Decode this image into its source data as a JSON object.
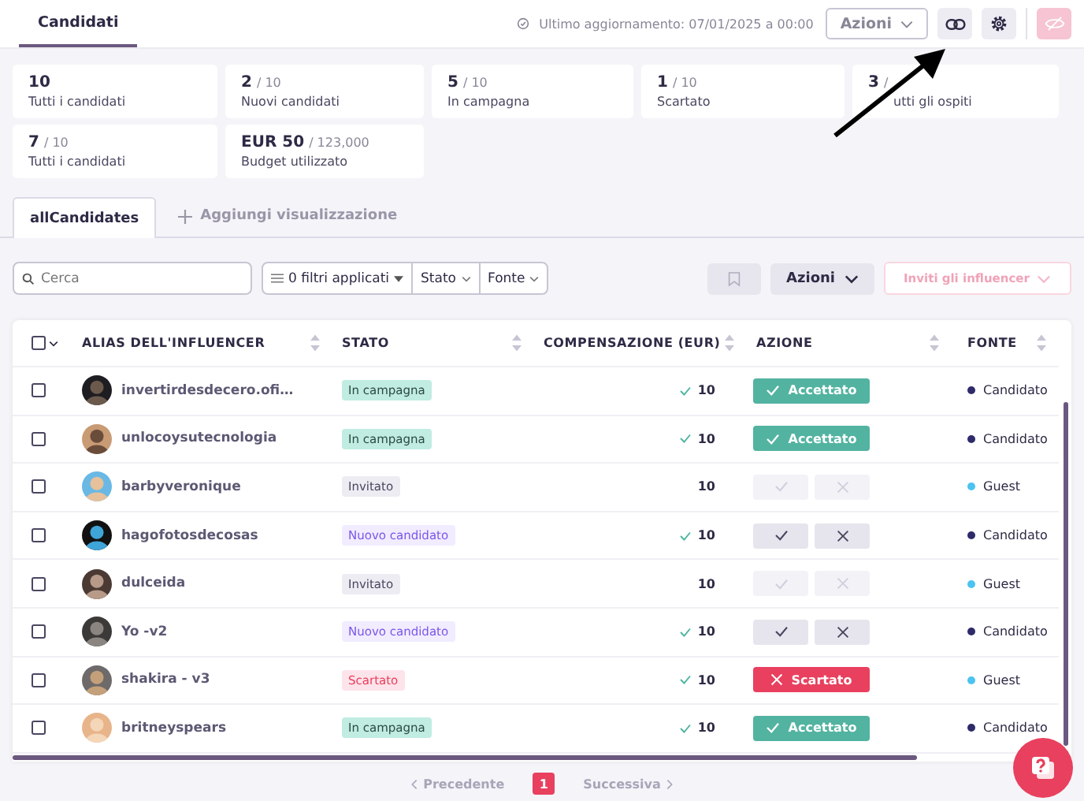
{
  "header": {
    "tab": "Candidati",
    "updated": "Ultimo aggiornamento: 07/01/2025 a 00:00",
    "actions_button": "Azioni"
  },
  "stats": [
    {
      "value": "10",
      "label": "Tutti i candidati"
    },
    {
      "value": "2",
      "total": "/ 10",
      "label": "Nuovi candidati"
    },
    {
      "value": "5",
      "total": "/ 10",
      "label": "In campagna"
    },
    {
      "value": "1",
      "total": "/ 10",
      "label": "Scartato"
    },
    {
      "value": "3",
      "total": "/",
      "label": "utti gli ospiti"
    },
    {
      "value": "7",
      "total": "/ 10",
      "label": "Tutti i candidati"
    },
    {
      "value": "EUR 50",
      "total": "/ 123,000",
      "label": "Budget utilizzato"
    }
  ],
  "views": [
    {
      "label": "allCandidates",
      "selected": true
    }
  ],
  "add_view": "Aggiungi visualizzazione",
  "toolbar": {
    "search_placeholder": "Cerca",
    "filters": "0 filtri applicati",
    "filter_stato": "Stato",
    "filter_fonte": "Fonte",
    "actions": "Azioni",
    "invite": "Inviti gli influencer"
  },
  "table": {
    "select_all": {
      "checked": false
    },
    "columns": [
      "ALIAS DELL'INFLUENCER",
      "STATO",
      "COMPENSAZIONE (EUR)",
      "AZIONE",
      "FONTE"
    ],
    "rows": [
      {
        "checked": false,
        "alias": "invertirdesdecero.ofi…",
        "status": {
          "kind": "campaign",
          "label": "In campagna"
        },
        "comp": "10",
        "comp_confirmed": true,
        "action": {
          "kind": "accepted",
          "label": "Accettato"
        },
        "source": "Candidato",
        "color": "#2e2a6b"
      },
      {
        "checked": false,
        "alias": "unlocoysutecnologia",
        "status": {
          "kind": "campaign",
          "label": "In campagna"
        },
        "comp": "10",
        "comp_confirmed": true,
        "action": {
          "kind": "accepted",
          "label": "Accettato"
        },
        "source": "Candidato",
        "color": "#2e2a6b"
      },
      {
        "checked": false,
        "alias": "barbyveronique",
        "status": {
          "kind": "invited",
          "label": "Invitato"
        },
        "comp": "10",
        "comp_confirmed": false,
        "action": {
          "kind": "pending",
          "disabled": true
        },
        "source": "Guest",
        "color": "#4cc3f0"
      },
      {
        "checked": false,
        "alias": "hagofotosdecosas",
        "status": {
          "kind": "new",
          "label": "Nuovo candidato"
        },
        "comp": "10",
        "comp_confirmed": true,
        "action": {
          "kind": "pending",
          "disabled": false
        },
        "source": "Candidato",
        "color": "#2e2a6b"
      },
      {
        "checked": false,
        "alias": "dulceida",
        "status": {
          "kind": "invited",
          "label": "Invitato"
        },
        "comp": "10",
        "comp_confirmed": false,
        "action": {
          "kind": "pending",
          "disabled": true
        },
        "source": "Guest",
        "color": "#4cc3f0"
      },
      {
        "checked": false,
        "alias": "Yo -v2",
        "status": {
          "kind": "new",
          "label": "Nuovo candidato"
        },
        "comp": "10",
        "comp_confirmed": true,
        "action": {
          "kind": "pending",
          "disabled": false
        },
        "source": "Candidato",
        "color": "#2e2a6b"
      },
      {
        "checked": false,
        "alias": "shakira - v3",
        "status": {
          "kind": "rejected",
          "label": "Scartato"
        },
        "comp": "10",
        "comp_confirmed": true,
        "action": {
          "kind": "rejected",
          "label": "Scartato"
        },
        "source": "Guest",
        "color": "#4cc3f0"
      },
      {
        "checked": false,
        "alias": "britneyspears",
        "status": {
          "kind": "campaign",
          "label": "In campagna"
        },
        "comp": "10",
        "comp_confirmed": true,
        "action": {
          "kind": "accepted",
          "label": "Accettato"
        },
        "source": "Candidato",
        "color": "#2e2a6b"
      }
    ]
  },
  "pagination": {
    "prev": "Precedente",
    "pages": [
      {
        "label": "1",
        "selected": true
      }
    ],
    "next": "Successiva"
  }
}
